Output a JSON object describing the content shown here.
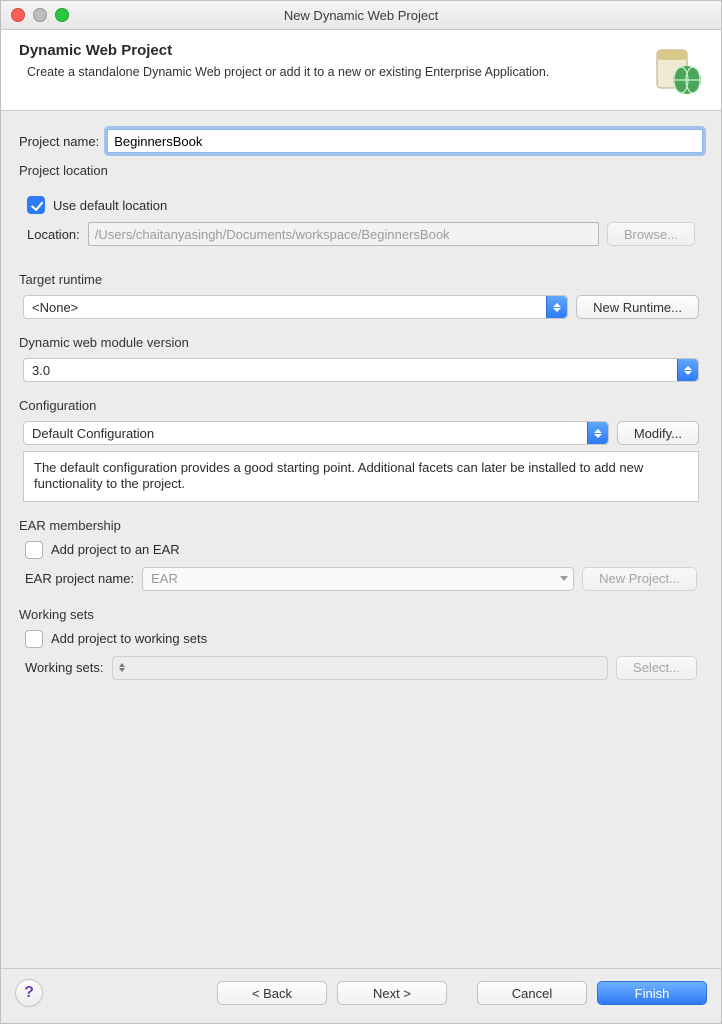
{
  "window": {
    "title": "New Dynamic Web Project"
  },
  "header": {
    "title": "Dynamic Web Project",
    "description": "Create a standalone Dynamic Web project or add it to a new or existing Enterprise Application."
  },
  "projectName": {
    "label": "Project name:",
    "value": "BeginnersBook"
  },
  "location": {
    "group_title": "Project location",
    "use_default_label": "Use default location",
    "use_default_checked": true,
    "label": "Location:",
    "value": "/Users/chaitanyasingh/Documents/workspace/BeginnersBook",
    "browse": "Browse..."
  },
  "runtime": {
    "group_title": "Target runtime",
    "value": "<None>",
    "new_button": "New Runtime..."
  },
  "module": {
    "group_title": "Dynamic web module version",
    "value": "3.0"
  },
  "config": {
    "group_title": "Configuration",
    "value": "Default Configuration",
    "modify": "Modify...",
    "description": "The default configuration provides a good starting point. Additional facets can later be installed to add new functionality to the project."
  },
  "ear": {
    "group_title": "EAR membership",
    "add_label": "Add project to an EAR",
    "add_checked": false,
    "name_label": "EAR project name:",
    "name_value": "EAR",
    "new_button": "New Project..."
  },
  "ws": {
    "group_title": "Working sets",
    "add_label": "Add project to working sets",
    "add_checked": false,
    "label": "Working sets:",
    "value": "",
    "select": "Select..."
  },
  "footer": {
    "back": "< Back",
    "next": "Next >",
    "cancel": "Cancel",
    "finish": "Finish"
  }
}
